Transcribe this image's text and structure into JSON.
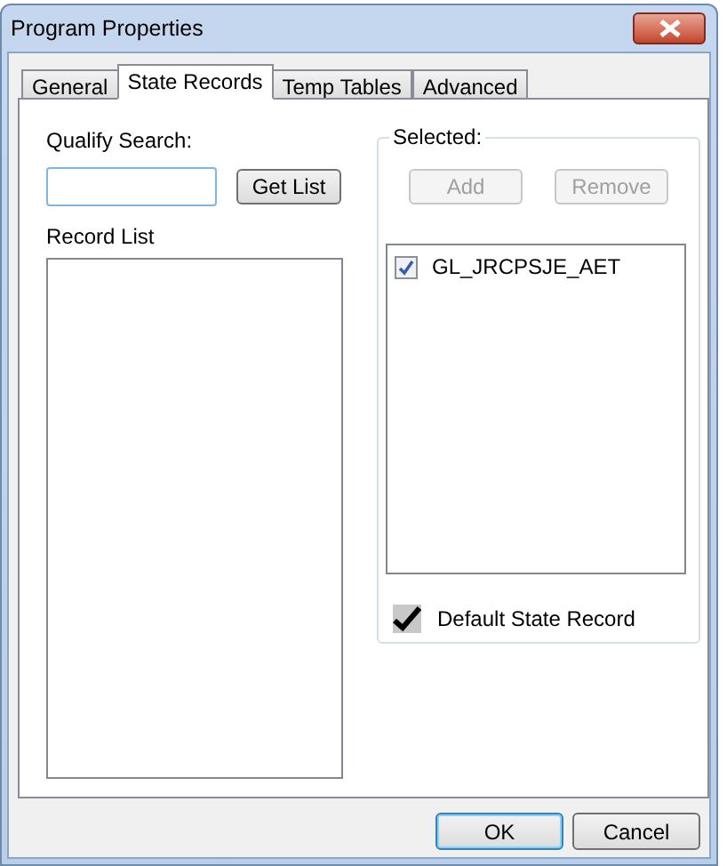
{
  "window": {
    "title": "Program Properties"
  },
  "tabs": [
    {
      "label": "General",
      "selected": false
    },
    {
      "label": "State Records",
      "selected": true
    },
    {
      "label": "Temp Tables",
      "selected": false
    },
    {
      "label": "Advanced",
      "selected": false
    }
  ],
  "qualify_search": {
    "label": "Qualify Search:",
    "get_list_button": "Get List"
  },
  "record_list": {
    "label": "Record List"
  },
  "selected_group": {
    "label": "Selected:",
    "buttons": [
      {
        "label": "Add",
        "disabled": true
      },
      {
        "label": "Remove",
        "disabled": true
      }
    ],
    "items": [
      {
        "label": "GL_JRCPSJE_AET",
        "checked": true
      }
    ],
    "default_state_record": {
      "label": "Default State Record",
      "checked": true
    }
  },
  "buttons": [
    {
      "label": "OK",
      "default": true
    },
    {
      "label": "Cancel",
      "default": false
    }
  ]
}
